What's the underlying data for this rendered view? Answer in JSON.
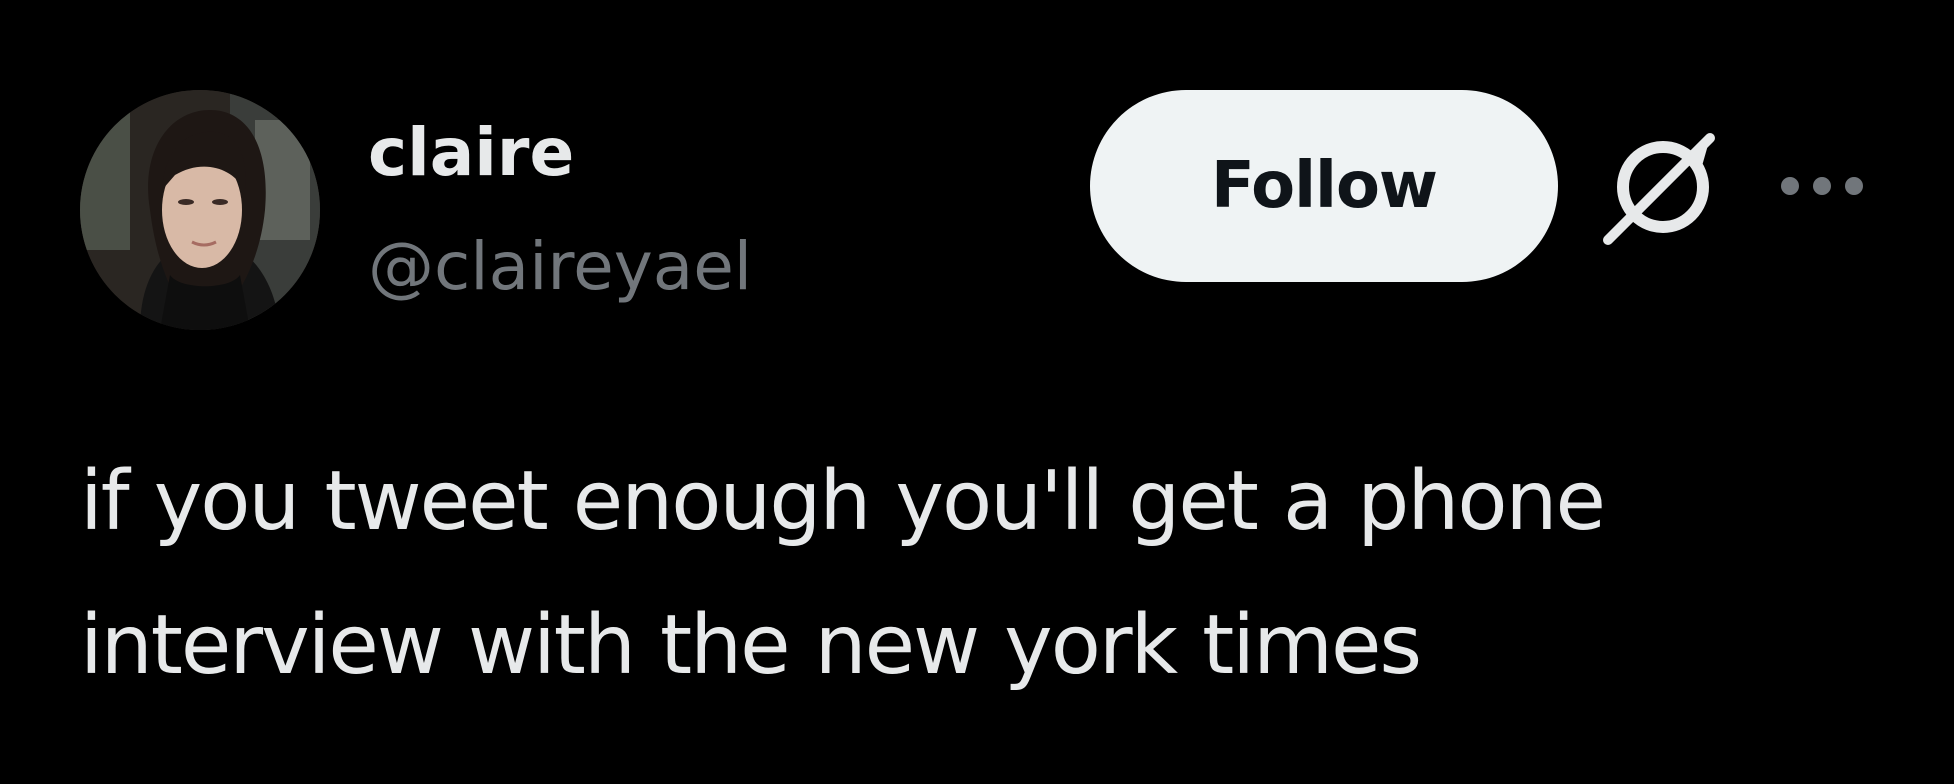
{
  "author": {
    "display_name": "claire",
    "handle": "@claireyael",
    "avatar_icon": "profile-photo"
  },
  "actions": {
    "follow_label": "Follow",
    "grok_icon": "grok-icon",
    "more_icon": "more-icon"
  },
  "tweet": {
    "text": "if you tweet enough you'll get a phone interview with the new york times"
  },
  "colors": {
    "background": "#000000",
    "primary_text": "#e7e9ea",
    "secondary_text": "#71767b",
    "follow_button_bg": "#eff3f4",
    "follow_button_text": "#0f1419"
  }
}
